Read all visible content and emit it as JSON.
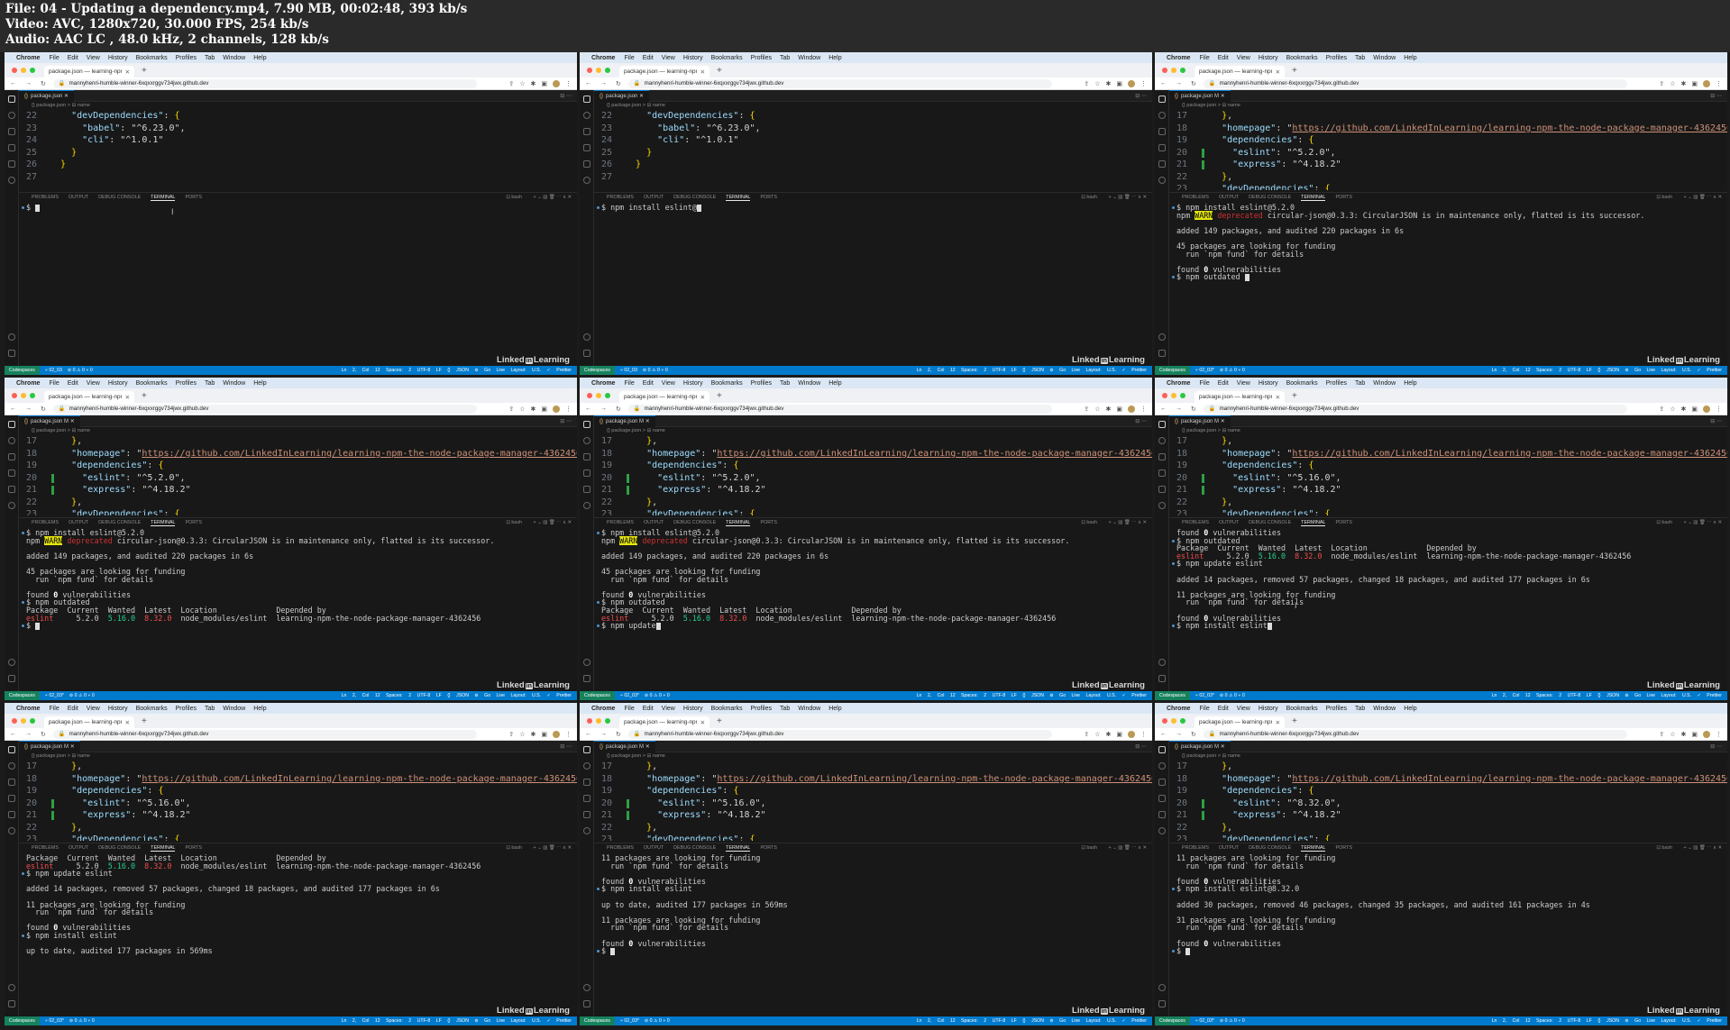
{
  "file_info": {
    "line1": "File: 04 - Updating a dependency.mp4, 7.90 MB, 00:02:48, 393 kb/s",
    "line2": "Video: AVC, 1280x720, 30.000 FPS, 254 kb/s",
    "line3": "Audio: AAC LC , 48.0 kHz, 2 channels, 128 kb/s"
  },
  "browser": {
    "app_name": "Chrome",
    "menu": [
      "File",
      "Edit",
      "View",
      "History",
      "Bookmarks",
      "Profiles",
      "Tab",
      "Window",
      "Help"
    ],
    "tab_title": "package.json — learning-npm",
    "url": "mannyhenri-humble-winner-6xqxxrggv734jwx.github.dev"
  },
  "editor": {
    "breadcrumb": "{} package.json > ⊟ name",
    "panel_tabs": [
      "PROBLEMS",
      "OUTPUT",
      "DEBUG CONSOLE",
      "TERMINAL",
      "PORTS"
    ],
    "shell": "bash"
  },
  "watermark": {
    "pre": "Linked",
    "in": "in",
    "post": "Learning"
  },
  "accent_colors": {
    "status_bar": "#007acc",
    "remote": "#16825d",
    "warn_bg": "#e5e510"
  },
  "frames": [
    {
      "editor_tab": "package.json",
      "branch": "02_03",
      "code": [
        [
          "22",
          "    \"devDependencies\": {"
        ],
        [
          "23",
          "      \"babel\": \"^6.23.0\","
        ],
        [
          "24",
          "      \"cli\": \"^1.0.1\""
        ],
        [
          "25",
          "    }"
        ],
        [
          "26",
          "  }"
        ],
        [
          "27",
          ""
        ]
      ],
      "terminal": [
        "$ "
      ]
    },
    {
      "editor_tab": "package.json",
      "branch": "02_03",
      "code": [
        [
          "22",
          "    \"devDependencies\": {"
        ],
        [
          "23",
          "      \"babel\": \"^6.23.0\","
        ],
        [
          "24",
          "      \"cli\": \"^1.0.1\""
        ],
        [
          "25",
          "    }"
        ],
        [
          "26",
          "  }"
        ],
        [
          "27",
          ""
        ]
      ],
      "terminal": [
        "$ npm install eslint@"
      ]
    },
    {
      "editor_tab": "package.json M",
      "branch": "02_03*",
      "code": [
        [
          "17",
          "    },"
        ],
        [
          "18",
          "    \"homepage\": \"https://github.com/LinkedInLearning/learning-npm-the-node-package-manager-4362456\","
        ],
        [
          "19",
          "    \"dependencies\": {"
        ],
        [
          "20",
          "      \"eslint\": \"^5.2.0\","
        ],
        [
          "21",
          "      \"express\": \"^4.18.2\""
        ],
        [
          "22",
          "    },"
        ],
        [
          "23",
          "    \"devDependencies\": {"
        ]
      ],
      "terminal": [
        "$ npm install eslint@5.2.0",
        "npm WARN deprecated circular-json@0.3.3: CircularJSON is in maintenance only, flatted is its successor.",
        "",
        "added 149 packages, and audited 220 packages in 6s",
        "",
        "45 packages are looking for funding",
        "  run `npm fund` for details",
        "",
        "found 0 vulnerabilities",
        "$ npm outdated "
      ]
    },
    {
      "editor_tab": "package.json M",
      "branch": "02_03*",
      "code": [
        [
          "17",
          "    },"
        ],
        [
          "18",
          "    \"homepage\": \"https://github.com/LinkedInLearning/learning-npm-the-node-package-manager-4362456\","
        ],
        [
          "19",
          "    \"dependencies\": {"
        ],
        [
          "20",
          "      \"eslint\": \"^5.2.0\","
        ],
        [
          "21",
          "      \"express\": \"^4.18.2\""
        ],
        [
          "22",
          "    },"
        ],
        [
          "23",
          "    \"devDependencies\": {"
        ]
      ],
      "terminal": [
        "$ npm install eslint@5.2.0",
        "npm WARN deprecated circular-json@0.3.3: CircularJSON is in maintenance only, flatted is its successor.",
        "",
        "added 149 packages, and audited 220 packages in 6s",
        "",
        "45 packages are looking for funding",
        "  run `npm fund` for details",
        "",
        "found 0 vulnerabilities",
        "$ npm outdated",
        "Package  Current  Wanted  Latest  Location             Depended by",
        "eslint     5.2.0  5.16.0  8.32.0  node_modules/eslint  learning-npm-the-node-package-manager-4362456",
        "$ "
      ]
    },
    {
      "editor_tab": "package.json M",
      "branch": "02_03*",
      "code": [
        [
          "17",
          "    },"
        ],
        [
          "18",
          "    \"homepage\": \"https://github.com/LinkedInLearning/learning-npm-the-node-package-manager-4362456\","
        ],
        [
          "19",
          "    \"dependencies\": {"
        ],
        [
          "20",
          "      \"eslint\": \"^5.2.0\","
        ],
        [
          "21",
          "      \"express\": \"^4.18.2\""
        ],
        [
          "22",
          "    },"
        ],
        [
          "23",
          "    \"devDependencies\": {"
        ]
      ],
      "terminal": [
        "$ npm install eslint@5.2.0",
        "npm WARN deprecated circular-json@0.3.3: CircularJSON is in maintenance only, flatted is its successor.",
        "",
        "added 149 packages, and audited 220 packages in 6s",
        "",
        "45 packages are looking for funding",
        "  run `npm fund` for details",
        "",
        "found 0 vulnerabilities",
        "$ npm outdated",
        "Package  Current  Wanted  Latest  Location             Depended by",
        "eslint     5.2.0  5.16.0  8.32.0  node_modules/eslint  learning-npm-the-node-package-manager-4362456",
        "$ npm update"
      ]
    },
    {
      "editor_tab": "package.json M",
      "branch": "02_03*",
      "code": [
        [
          "17",
          "    },"
        ],
        [
          "18",
          "    \"homepage\": \"https://github.com/LinkedInLearning/learning-npm-the-node-package-manager-4362456\","
        ],
        [
          "19",
          "    \"dependencies\": {"
        ],
        [
          "20",
          "      \"eslint\": \"^5.16.0\","
        ],
        [
          "21",
          "      \"express\": \"^4.18.2\""
        ],
        [
          "22",
          "    },"
        ],
        [
          "23",
          "    \"devDependencies\": {"
        ]
      ],
      "terminal": [
        "found 0 vulnerabilities",
        "$ npm outdated",
        "Package  Current  Wanted  Latest  Location             Depended by",
        "eslint     5.2.0  5.16.0  8.32.0  node_modules/eslint  learning-npm-the-node-package-manager-4362456",
        "$ npm update eslint",
        "",
        "added 14 packages, removed 57 packages, changed 18 packages, and audited 177 packages in 6s",
        "",
        "11 packages are looking for funding",
        "  run `npm fund` for details",
        "",
        "found 0 vulnerabilities",
        "$ npm install eslint"
      ]
    },
    {
      "editor_tab": "package.json M",
      "branch": "02_03*",
      "code": [
        [
          "17",
          "    },"
        ],
        [
          "18",
          "    \"homepage\": \"https://github.com/LinkedInLearning/learning-npm-the-node-package-manager-4362456\","
        ],
        [
          "19",
          "    \"dependencies\": {"
        ],
        [
          "20",
          "      \"eslint\": \"^5.16.0\","
        ],
        [
          "21",
          "      \"express\": \"^4.18.2\""
        ],
        [
          "22",
          "    },"
        ],
        [
          "23",
          "    \"devDependencies\": {"
        ]
      ],
      "terminal": [
        "Package  Current  Wanted  Latest  Location             Depended by",
        "eslint     5.2.0  5.16.0  8.32.0  node_modules/eslint  learning-npm-the-node-package-manager-4362456",
        "$ npm update eslint",
        "",
        "added 14 packages, removed 57 packages, changed 18 packages, and audited 177 packages in 6s",
        "",
        "11 packages are looking for funding",
        "  run `npm fund` for details",
        "",
        "found 0 vulnerabilities",
        "$ npm install eslint",
        "",
        "up to date, audited 177 packages in 569ms"
      ]
    },
    {
      "editor_tab": "package.json M",
      "branch": "02_03*",
      "code": [
        [
          "17",
          "    },"
        ],
        [
          "18",
          "    \"homepage\": \"https://github.com/LinkedInLearning/learning-npm-the-node-package-manager-4362456\","
        ],
        [
          "19",
          "    \"dependencies\": {"
        ],
        [
          "20",
          "      \"eslint\": \"^5.16.0\","
        ],
        [
          "21",
          "      \"express\": \"^4.18.2\""
        ],
        [
          "22",
          "    },"
        ],
        [
          "23",
          "    \"devDependencies\": {"
        ]
      ],
      "terminal": [
        "11 packages are looking for funding",
        "  run `npm fund` for details",
        "",
        "found 0 vulnerabilities",
        "$ npm install eslint",
        "",
        "up to date, audited 177 packages in 569ms",
        "",
        "11 packages are looking for funding",
        "  run `npm fund` for details",
        "",
        "found 0 vulnerabilities",
        "$ "
      ]
    },
    {
      "editor_tab": "package.json M",
      "branch": "02_03*",
      "code": [
        [
          "17",
          "    },"
        ],
        [
          "18",
          "    \"homepage\": \"https://github.com/LinkedInLearning/learning-npm-the-node-package-manager-4362456\","
        ],
        [
          "19",
          "    \"dependencies\": {"
        ],
        [
          "20",
          "      \"eslint\": \"^8.32.0\","
        ],
        [
          "21",
          "      \"express\": \"^4.18.2\""
        ],
        [
          "22",
          "    },"
        ],
        [
          "23",
          "    \"devDependencies\": {"
        ]
      ],
      "terminal": [
        "11 packages are looking for funding",
        "  run `npm fund` for details",
        "",
        "found 0 vulnerabilities",
        "$ npm install eslint@8.32.0",
        "",
        "added 30 packages, removed 46 packages, changed 35 packages, and audited 161 packages in 4s",
        "",
        "31 packages are looking for funding",
        "  run `npm fund` for details",
        "",
        "found 0 vulnerabilities",
        "$ "
      ]
    }
  ],
  "status_bar": {
    "remote": "Codespaces",
    "left_extra": "⊘ 0 ⚠ 0   ⑂ 0",
    "right": "Ln 2, Col 12  Spaces: 2  UTF-8  LF  {} JSON  ⊚ Go Live  Layout: U.S.  ✓ Prettier"
  }
}
